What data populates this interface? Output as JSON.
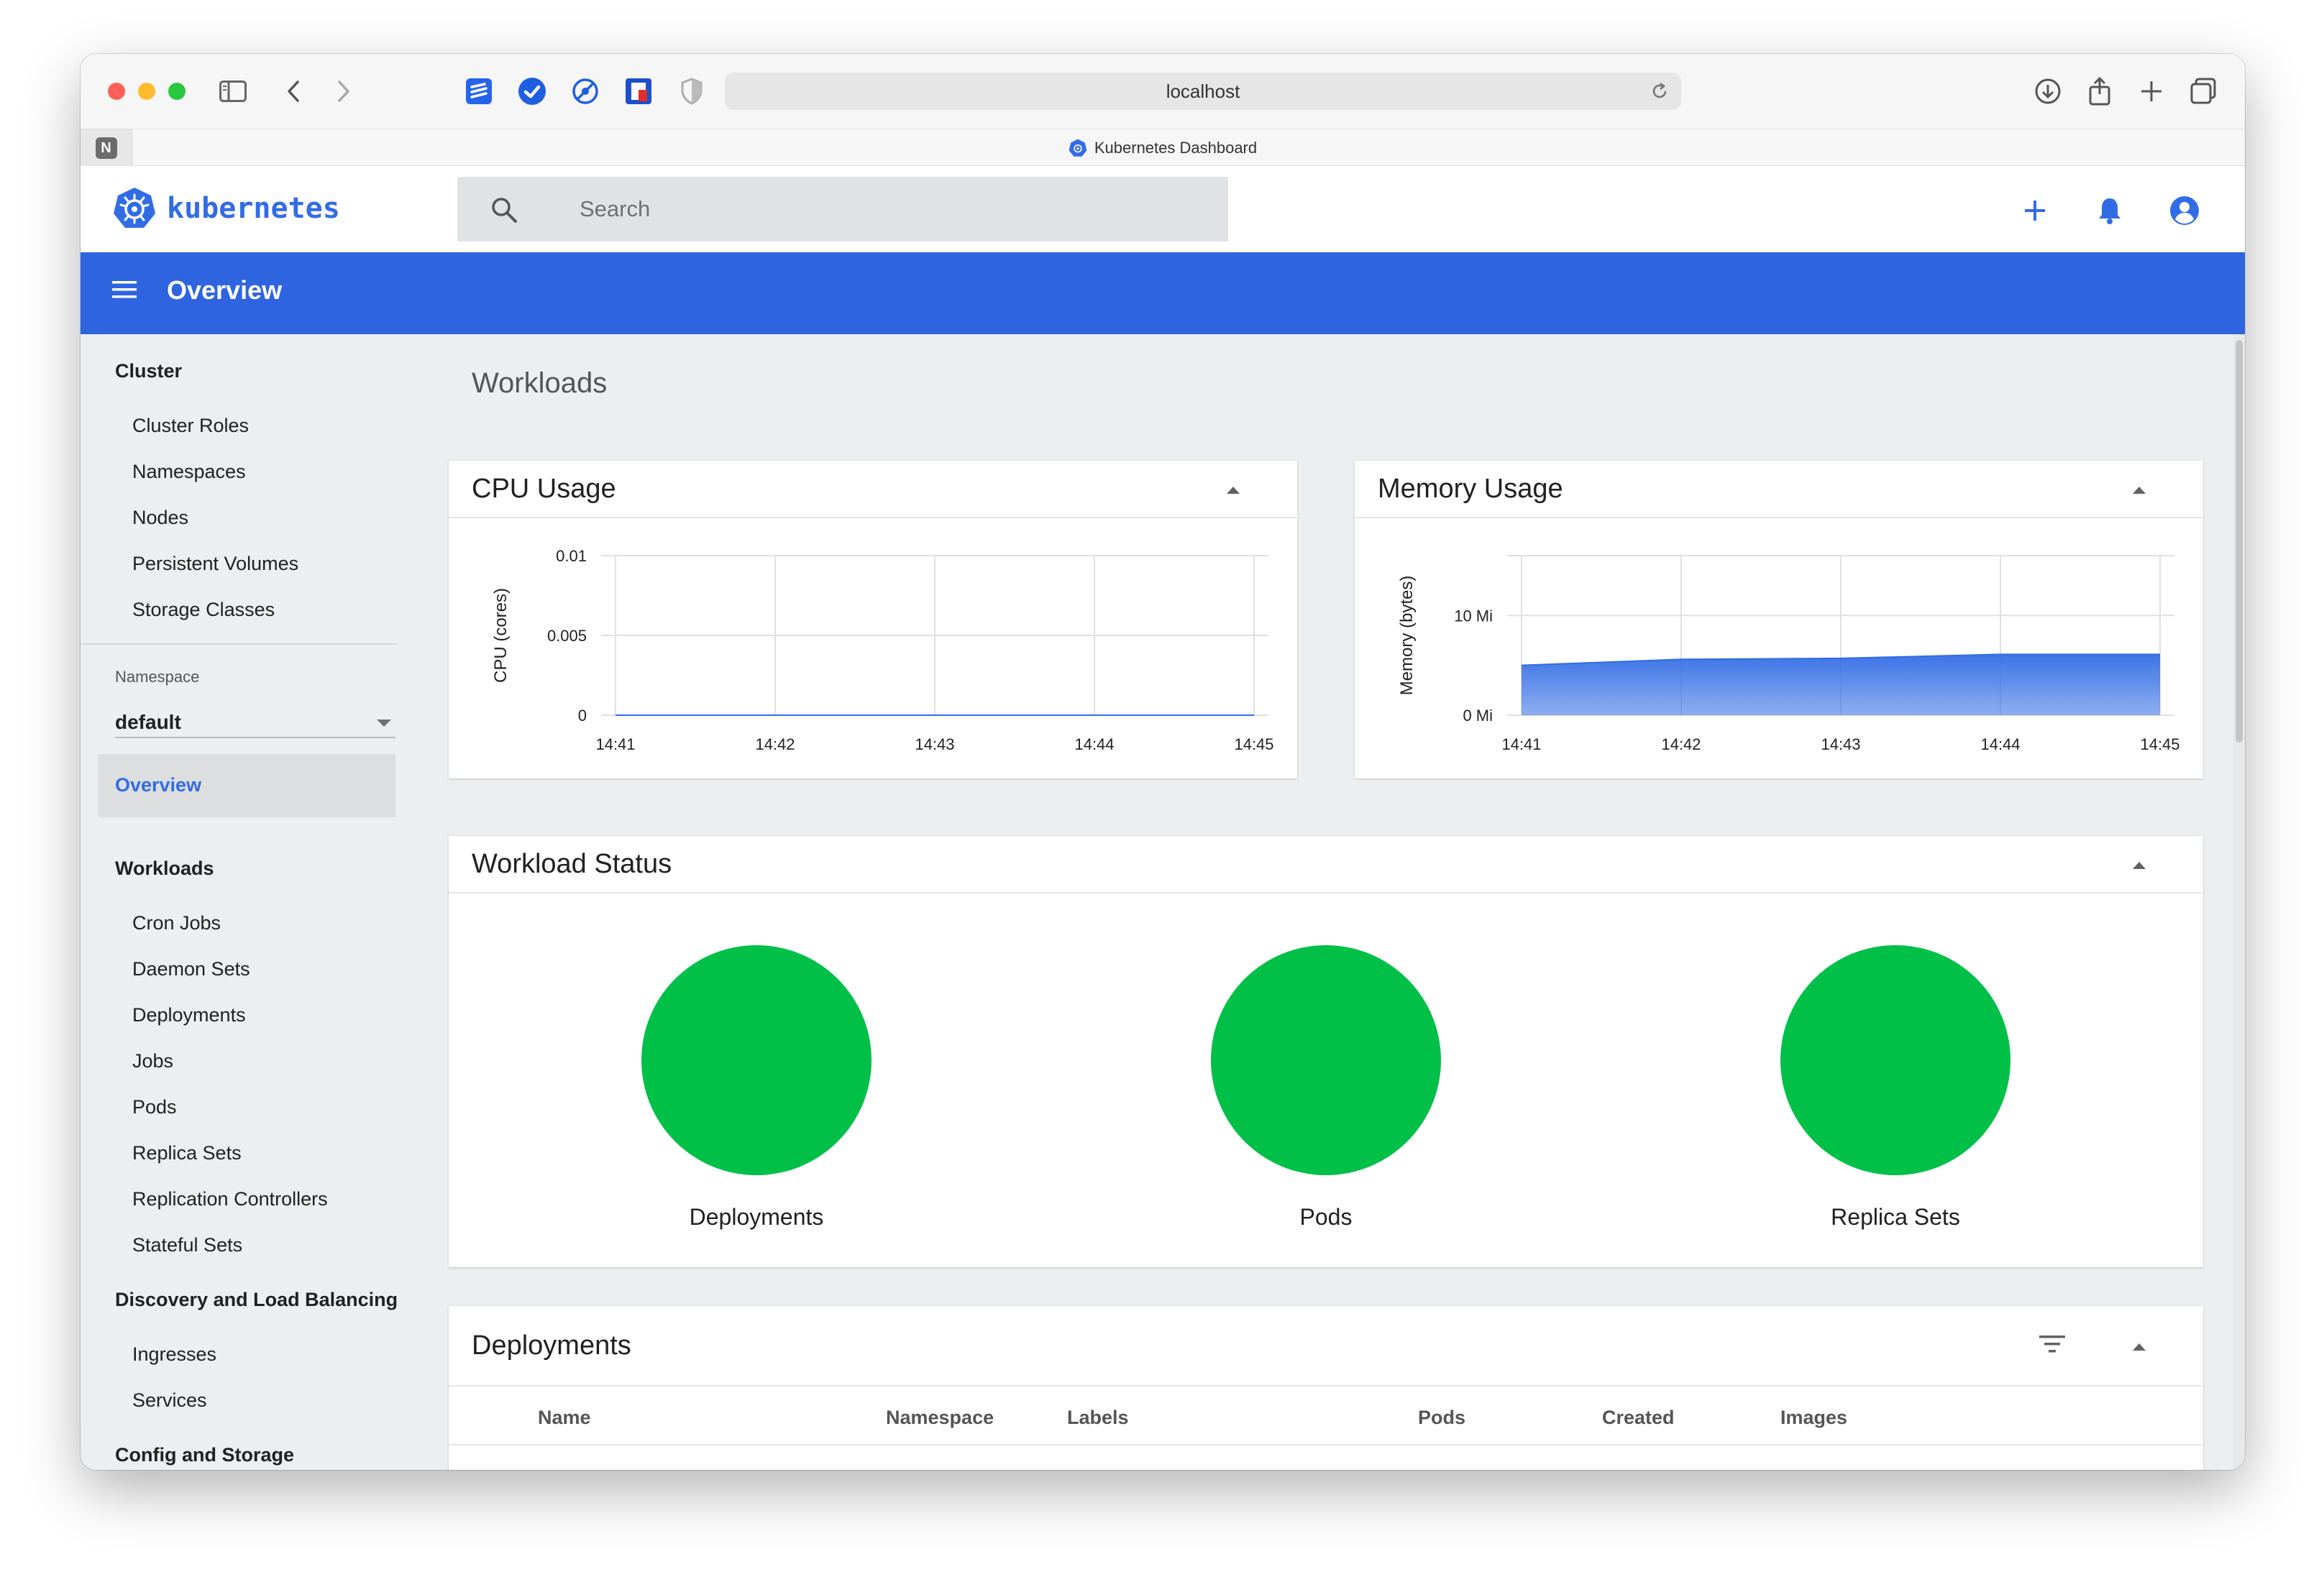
{
  "browser": {
    "url": "localhost",
    "tab_title": "Kubernetes Dashboard",
    "pinned_tab_letter": "N"
  },
  "header": {
    "brand": "kubernetes",
    "search_placeholder": "Search"
  },
  "toolbar": {
    "title": "Overview"
  },
  "sidebar": {
    "cluster_heading": "Cluster",
    "cluster_items": [
      "Cluster Roles",
      "Namespaces",
      "Nodes",
      "Persistent Volumes",
      "Storage Classes"
    ],
    "namespace_label": "Namespace",
    "namespace_value": "default",
    "active_item": "Overview",
    "workloads_heading": "Workloads",
    "workload_items": [
      "Cron Jobs",
      "Daemon Sets",
      "Deployments",
      "Jobs",
      "Pods",
      "Replica Sets",
      "Replication Controllers",
      "Stateful Sets"
    ],
    "discovery_heading": "Discovery and Load Balancing",
    "discovery_items": [
      "Ingresses",
      "Services"
    ],
    "config_heading": "Config and Storage"
  },
  "main": {
    "section_title": "Workloads",
    "cpu_card_title": "CPU Usage",
    "memory_card_title": "Memory Usage",
    "workload_status_title": "Workload Status",
    "status_items": [
      {
        "label": "Deployments",
        "color": "#00c048"
      },
      {
        "label": "Pods",
        "color": "#00c048"
      },
      {
        "label": "Replica Sets",
        "color": "#00c048"
      }
    ],
    "deployments_title": "Deployments",
    "table_headers": [
      "Name",
      "Namespace",
      "Labels",
      "Pods",
      "Created",
      "Images"
    ]
  },
  "chart_data": [
    {
      "type": "line",
      "title": "CPU Usage",
      "ylabel": "CPU (cores)",
      "x": [
        "14:41",
        "14:42",
        "14:43",
        "14:44",
        "14:45"
      ],
      "y_ticks": [
        "0",
        "0.005",
        "0.01"
      ],
      "ylim": [
        0,
        0.01
      ],
      "series": [
        {
          "values": [
            0,
            0,
            0,
            0,
            0
          ]
        }
      ],
      "grid": true
    },
    {
      "type": "area",
      "title": "Memory Usage",
      "ylabel": "Memory (bytes)",
      "x": [
        "14:41",
        "14:42",
        "14:43",
        "14:44",
        "14:45"
      ],
      "y_ticks": [
        "0 Mi",
        "10 Mi"
      ],
      "ylim": [
        0,
        16
      ],
      "series": [
        {
          "values": [
            5.0,
            5.6,
            5.7,
            6.1,
            6.1
          ],
          "color": "#326ce5"
        }
      ],
      "grid": true
    }
  ],
  "colors": {
    "accent": "#326ce5",
    "toolbar": "#2e64e0",
    "status_ok": "#00c048"
  }
}
